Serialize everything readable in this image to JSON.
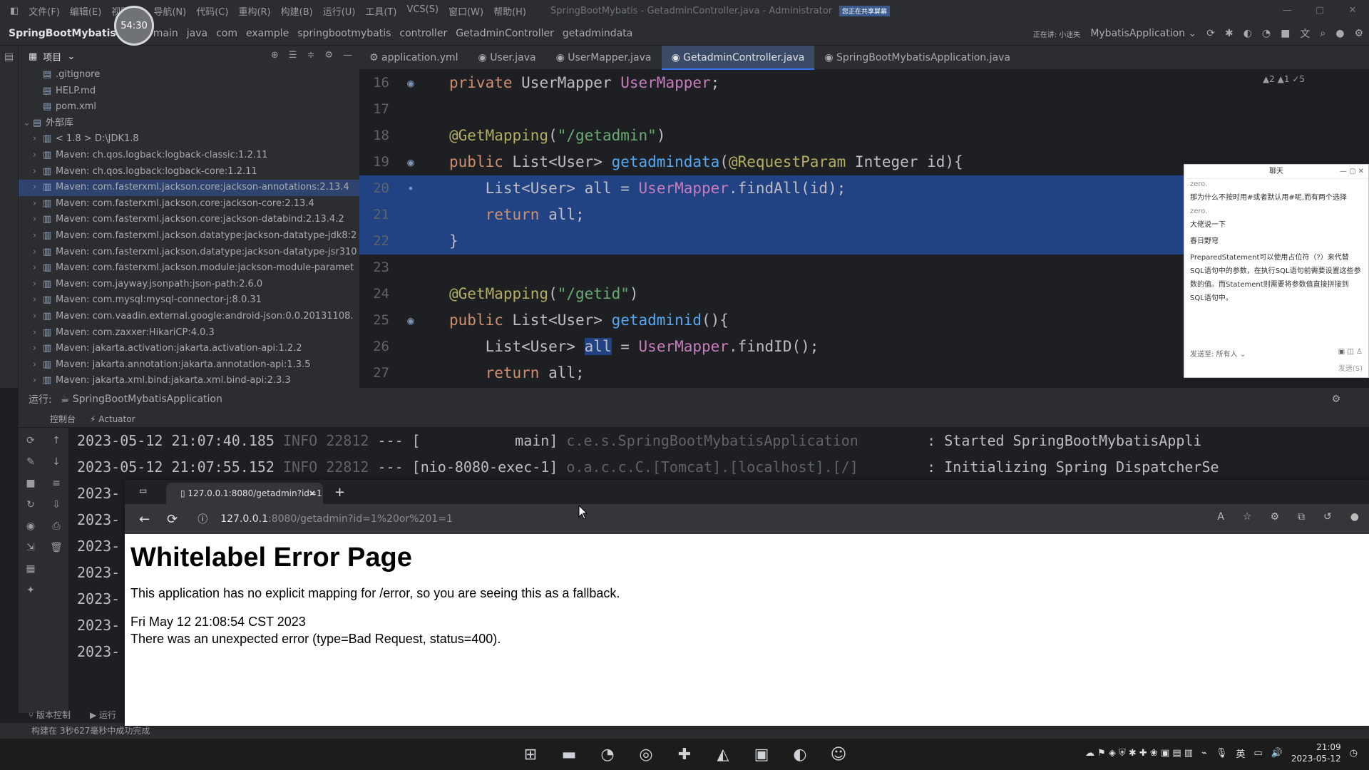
{
  "menubar": {
    "items": [
      "文件(F)",
      "编辑(E)",
      "视图(V)",
      "导航(N)",
      "代码(C)",
      "重构(R)",
      "构建(B)",
      "运行(U)",
      "工具(T)",
      "VCS(S)",
      "窗口(W)",
      "帮助(H)"
    ],
    "window_title": "SpringBootMybatis - GetadminController.java - Administrator",
    "sharing_badge": "您正在共享屏幕"
  },
  "timer": "54:30",
  "navbar": {
    "project": "SpringBootMybatis",
    "breadcrumbs": [
      "main",
      "java",
      "com",
      "example",
      "springbootmybatis",
      "controller",
      "GetadminController",
      "getadmindata"
    ],
    "run_config": "MybatisApplication",
    "status_text": "正在讲: 小迷失"
  },
  "project_panel": {
    "title": "项目",
    "items": [
      {
        "label": ".gitignore",
        "indent": 1,
        "chev": ""
      },
      {
        "label": "HELP.md",
        "indent": 1,
        "chev": ""
      },
      {
        "label": "pom.xml",
        "indent": 1,
        "chev": ""
      },
      {
        "label": "外部库",
        "indent": 0,
        "chev": "⌄"
      },
      {
        "label": "< 1.8 >  D:\\JDK1.8",
        "indent": 1,
        "chev": "›"
      },
      {
        "label": "Maven: ch.qos.logback:logback-classic:1.2.11",
        "indent": 1,
        "chev": "›"
      },
      {
        "label": "Maven: ch.qos.logback:logback-core:1.2.11",
        "indent": 1,
        "chev": "›"
      },
      {
        "label": "Maven: com.fasterxml.jackson.core:jackson-annotations:2.13.4",
        "indent": 1,
        "chev": "›"
      },
      {
        "label": "Maven: com.fasterxml.jackson.core:jackson-core:2.13.4",
        "indent": 1,
        "chev": "›"
      },
      {
        "label": "Maven: com.fasterxml.jackson.core:jackson-databind:2.13.4.2",
        "indent": 1,
        "chev": "›"
      },
      {
        "label": "Maven: com.fasterxml.jackson.datatype:jackson-datatype-jdk8:2",
        "indent": 1,
        "chev": "›"
      },
      {
        "label": "Maven: com.fasterxml.jackson.datatype:jackson-datatype-jsr310",
        "indent": 1,
        "chev": "›"
      },
      {
        "label": "Maven: com.fasterxml.jackson.module:jackson-module-paramet",
        "indent": 1,
        "chev": "›"
      },
      {
        "label": "Maven: com.jayway.jsonpath:json-path:2.6.0",
        "indent": 1,
        "chev": "›"
      },
      {
        "label": "Maven: com.mysql:mysql-connector-j:8.0.31",
        "indent": 1,
        "chev": "›"
      },
      {
        "label": "Maven: com.vaadin.external.google:android-json:0.0.20131108.",
        "indent": 1,
        "chev": "›"
      },
      {
        "label": "Maven: com.zaxxer:HikariCP:4.0.3",
        "indent": 1,
        "chev": "›"
      },
      {
        "label": "Maven: jakarta.activation:jakarta.activation-api:1.2.2",
        "indent": 1,
        "chev": "›"
      },
      {
        "label": "Maven: jakarta.annotation:jakarta.annotation-api:1.3.5",
        "indent": 1,
        "chev": "›"
      },
      {
        "label": "Maven: jakarta.xml.bind:jakarta.xml.bind-api:2.3.3",
        "indent": 1,
        "chev": "›"
      }
    ]
  },
  "editor": {
    "tabs": [
      "application.yml",
      "User.java",
      "UserMapper.java",
      "GetadminController.java",
      "SpringBootMybatisApplication.java"
    ],
    "active_tab": 3,
    "inspection": "▲2 ▲1 ✓5",
    "lines": [
      {
        "n": "16",
        "html": "<span class='kw'>private</span> UserMapper <span class='fld'>UserMapper</span>;"
      },
      {
        "n": "17",
        "html": ""
      },
      {
        "n": "18",
        "html": "<span class='an'>@GetMapping</span>(<span class='str'>\"/getadmin\"</span>)"
      },
      {
        "n": "19",
        "html": "<span class='kw'>public</span> List&lt;User&gt; <span class='mt'>getadmindata</span>(<span class='an'>@RequestParam</span> Integer id){"
      },
      {
        "n": "20",
        "html": "    List&lt;User&gt; <span class='hl'>all</span> = <span class='fld'>UserMapper</span>.findAll(id);"
      },
      {
        "n": "21",
        "html": "    <span class='kw'>return</span> all;"
      },
      {
        "n": "22",
        "html": "}"
      },
      {
        "n": "23",
        "html": ""
      },
      {
        "n": "24",
        "html": "<span class='an'>@GetMapping</span>(<span class='str'>\"/getid\"</span>)"
      },
      {
        "n": "25",
        "html": "<span class='kw'>public</span> List&lt;User&gt; <span class='mt'>getadminid</span>(){"
      },
      {
        "n": "26",
        "html": "    List&lt;User&gt; <span class='hl'>all</span> = <span class='fld'>UserMapper</span>.findID();"
      },
      {
        "n": "27",
        "html": "    <span class='kw'>return</span> all;"
      }
    ]
  },
  "chat": {
    "title": "聊天",
    "messages": [
      {
        "who": "zero.",
        "text": "那为什么不按时用#或者默认用#呢,而有两个选择"
      },
      {
        "who": "zero.",
        "text": "大佬说一下"
      },
      {
        "who": "",
        "text": "春日野穹"
      },
      {
        "who": "",
        "text": "PreparedStatement可以使用占位符（?）来代替SQL语句中的参数，在执行SQL语句前需要设置这些参数的值。而Statement则需要将参数值直接拼接到SQL语句中。"
      }
    ],
    "send_to_label": "发送至:",
    "send_to_value": "所有人",
    "send_button": "发送(S)"
  },
  "run_panel": {
    "label": "运行:",
    "config": "SpringBootMybatisApplication",
    "subtabs": [
      "控制台",
      "Actuator"
    ]
  },
  "console": {
    "lines": [
      {
        "ts": "2023-05-12 21:07:40.185",
        "level": "INFO",
        "pid": "22812",
        "thread": "[           main]",
        "logger": "c.e.s.SpringBootMybatisApplication",
        "msg": ": Started SpringBootMybatisAppli"
      },
      {
        "ts": "2023-05-12 21:07:55.152",
        "level": "INFO",
        "pid": "22812",
        "thread": "[nio-8080-exec-1]",
        "logger": "o.a.c.c.C.[Tomcat].[localhost].[/]",
        "msg": ": Initializing Spring DispatcherSe"
      },
      {
        "ts": "2023-"
      },
      {
        "ts": "2023-"
      },
      {
        "ts": "2023-"
      },
      {
        "ts": "2023-"
      },
      {
        "ts": "2023-"
      },
      {
        "ts": "2023-"
      },
      {
        "ts": "2023-"
      }
    ]
  },
  "browser": {
    "tab_title": "127.0.0.1:8080/getadmin?id=1 o",
    "url_host": "127.0.0.1",
    "url_rest": ":8080/getadmin?id=1%20or%201=1",
    "heading": "Whitelabel Error Page",
    "para1": "This application has no explicit mapping for /error, so you are seeing this as a fallback.",
    "para2": "Fri May 12 21:08:54 CST 2023",
    "para3": "There was an unexpected error (type=Bad Request, status=400)."
  },
  "statusbar": {
    "text": "构建在 3秒627毫秒中成功完成",
    "vc_label": "版本控制",
    "run_label": "运行"
  },
  "taskbar": {
    "time": "21:09",
    "date": "2023-05-12",
    "lang": "英"
  }
}
